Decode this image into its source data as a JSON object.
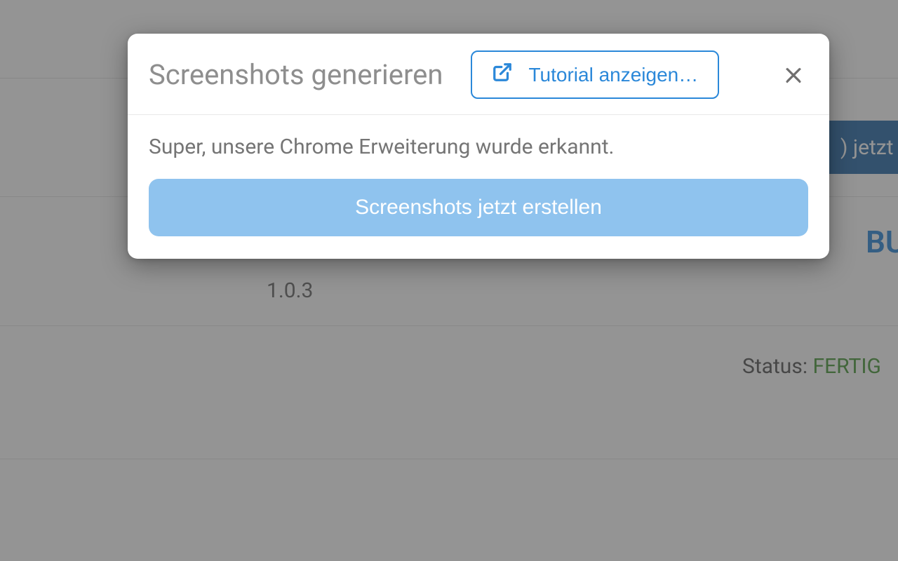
{
  "modal": {
    "title": "Screenshots generieren",
    "tutorial_label": "Tutorial anzeigen…",
    "close_aria": "×",
    "message": "Super, unsere Chrome Erweiterung wurde erkannt.",
    "primary_label": "Screenshots jetzt erstellen"
  },
  "background": {
    "build_btn_text": ") jetzt b",
    "bu_text": "BU",
    "version": "1.0.3",
    "status_label": "Status: ",
    "status_value": "FERTIG"
  }
}
